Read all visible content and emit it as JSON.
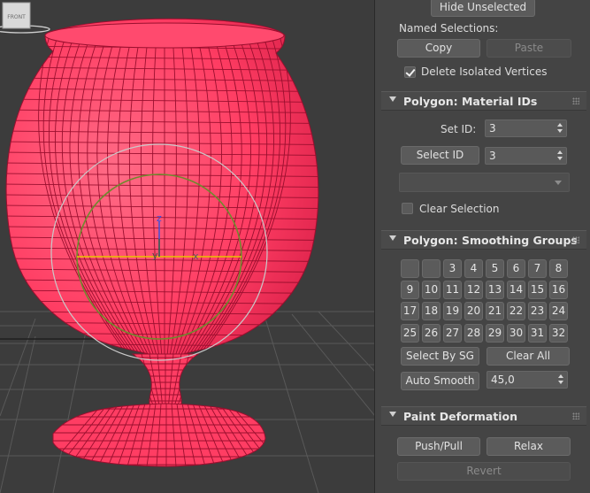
{
  "viewport": {
    "viewcube_label": "FRONT",
    "gizmo_axes": {
      "x": "x",
      "y": "y",
      "z": "z"
    },
    "colors": {
      "background": "#3c3c3c",
      "mesh_fill": "#ff3d63",
      "mesh_wire": "#9a0f2e",
      "grid": "#5a5a5a",
      "gizmo_circle": "#7a8a3c",
      "gizmo_outer": "#bdbdbd"
    }
  },
  "selection": {
    "hide_unselected_label": "Hide Unselected",
    "named_selections_label": "Named Selections:",
    "copy_label": "Copy",
    "paste_label": "Paste",
    "delete_isolated_label": "Delete Isolated Vertices",
    "delete_isolated_checked": true
  },
  "material_ids": {
    "title": "Polygon: Material IDs",
    "set_id_label": "Set ID:",
    "set_id_value": "3",
    "select_id_label": "Select ID",
    "select_id_value": "3",
    "material_dropdown_value": "",
    "clear_selection_label": "Clear Selection",
    "clear_selection_checked": false
  },
  "smoothing_groups": {
    "title": "Polygon: Smoothing Groups",
    "buttons": [
      "",
      "",
      "3",
      "4",
      "5",
      "6",
      "7",
      "8",
      "9",
      "10",
      "11",
      "12",
      "13",
      "14",
      "15",
      "16",
      "17",
      "18",
      "19",
      "20",
      "21",
      "22",
      "23",
      "24",
      "25",
      "26",
      "27",
      "28",
      "29",
      "30",
      "31",
      "32"
    ],
    "select_by_sg_label": "Select By SG",
    "clear_all_label": "Clear All",
    "auto_smooth_label": "Auto Smooth",
    "auto_smooth_value": "45,0"
  },
  "paint_deformation": {
    "title": "Paint Deformation",
    "push_pull_label": "Push/Pull",
    "relax_label": "Relax",
    "revert_label": "Revert"
  }
}
